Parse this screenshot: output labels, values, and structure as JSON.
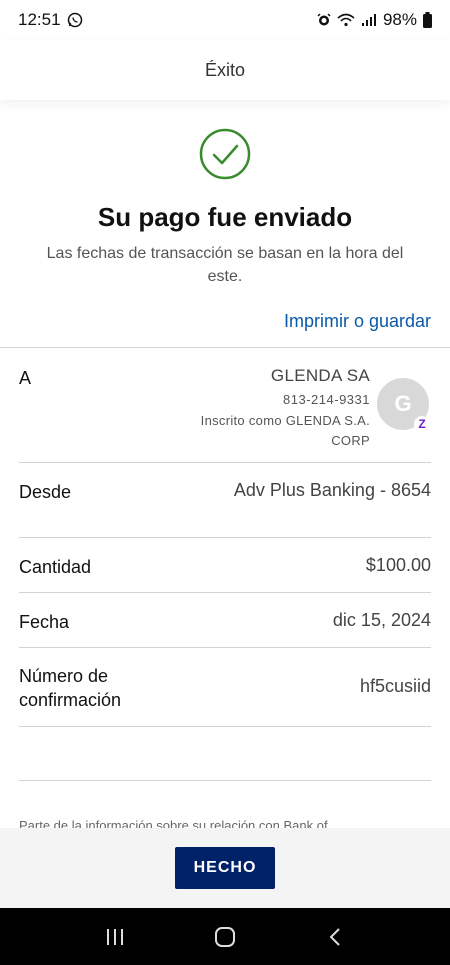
{
  "status_bar": {
    "time": "12:51",
    "battery": "98%",
    "icons": [
      "whatsapp-icon",
      "alarm-icon",
      "wifi-icon",
      "signal-icon",
      "battery-icon"
    ]
  },
  "header": {
    "title": "Éxito"
  },
  "confirmation": {
    "icon": "check-circle-icon",
    "title": "Su pago fue enviado",
    "subtitle": "Las fechas de transacción se basan en la hora del este.",
    "print_link": "Imprimir o guardar"
  },
  "details": {
    "to": {
      "label": "A",
      "name": "GLENDA SA",
      "phone": "813-214-9331",
      "enrolled": "Inscrito como GLENDA S.A. CORP",
      "avatar_initial": "G",
      "badge": "Z"
    },
    "from": {
      "label": "Desde",
      "value": "Adv Plus Banking - 8654"
    },
    "amount": {
      "label": "Cantidad",
      "value": "$100.00"
    },
    "date": {
      "label": "Fecha",
      "value": "dic 15, 2024"
    },
    "confirmation_number": {
      "label": "Número de confirmación",
      "value": "hf5cusiid"
    }
  },
  "disclaimer": "Parte de la información sobre su relación con Bank of",
  "actions": {
    "done_label": "HECHO"
  },
  "colors": {
    "success_green": "#3a8a2e",
    "link_blue": "#0a5aa8",
    "button_navy": "#012169",
    "zelle_purple": "#6d1ed4"
  }
}
